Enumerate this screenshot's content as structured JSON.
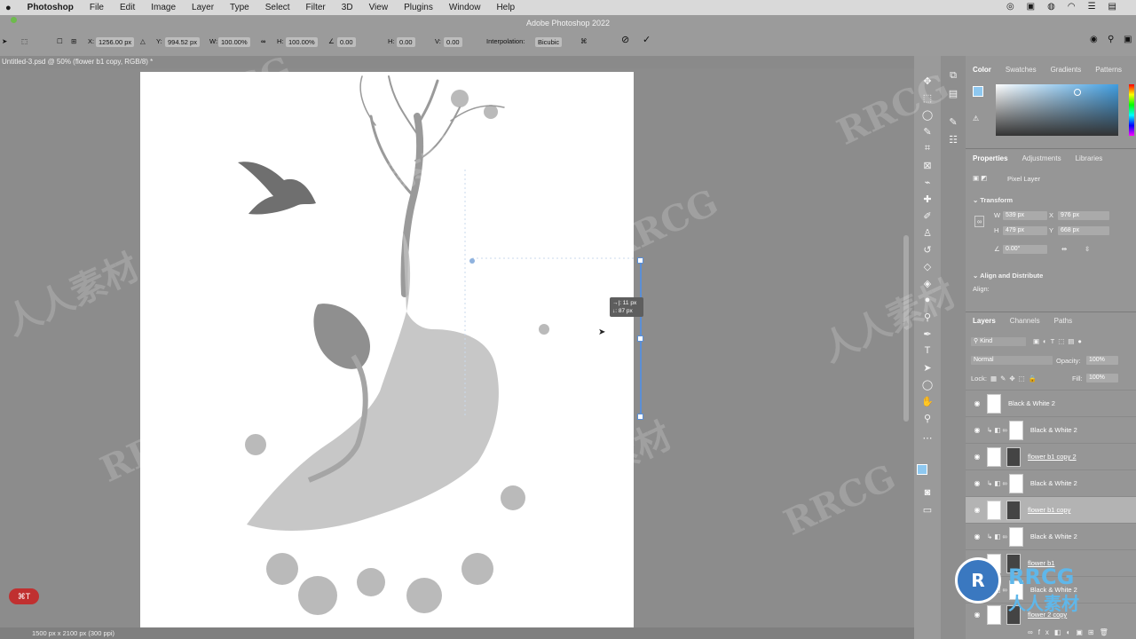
{
  "menubar": {
    "app": "Photoshop",
    "items": [
      "File",
      "Edit",
      "Image",
      "Layer",
      "Type",
      "Select",
      "Filter",
      "3D",
      "View",
      "Plugins",
      "Window",
      "Help"
    ]
  },
  "window_title": "Adobe Photoshop 2022",
  "options": {
    "x_label": "X:",
    "x_value": "1256.00 px",
    "y_label": "Y:",
    "y_value": "994.52 px",
    "w_label": "W:",
    "w_value": "100.00%",
    "h_label": "H:",
    "h_value": "100.00%",
    "angle_value": "0.00",
    "hskew_label": "H:",
    "hskew_value": "0.00",
    "vskew_label": "V:",
    "vskew_value": "0.00",
    "interp_label": "Interpolation:",
    "interp_value": "Bicubic"
  },
  "doc_tab": "Untitled-3.psd @ 50% (flower b1 copy, RGB/8) *",
  "status": "1500 px x 2100 px (300 ppi)",
  "measure": {
    "line1": "→|: 11 px",
    "line2": "↓: 87 px"
  },
  "shortcut_badge": "⌘T",
  "color_tabs": [
    "Color",
    "Swatches",
    "Gradients",
    "Patterns"
  ],
  "props_tabs": [
    "Properties",
    "Adjustments",
    "Libraries"
  ],
  "props": {
    "pixel_layer": "Pixel Layer",
    "transform": "Transform",
    "w_label": "W",
    "w": "539 px",
    "x_label": "X",
    "x": "976 px",
    "h_label": "H",
    "h": "479 px",
    "y_label": "Y",
    "y": "668 px",
    "angle": "0.00°",
    "align_distribute": "Align and Distribute",
    "align": "Align:"
  },
  "layers_tabs": [
    "Layers",
    "Channels",
    "Paths"
  ],
  "layers_ctrl": {
    "kind": "Kind",
    "blend": "Normal",
    "opacity_label": "Opacity:",
    "opacity": "100%",
    "lock_label": "Lock:",
    "fill_label": "Fill:",
    "fill": "100%"
  },
  "layers": [
    {
      "name": "Black & White 2"
    },
    {
      "name": "Black & White 2"
    },
    {
      "name": "flower b1 copy 2"
    },
    {
      "name": "Black & White 2"
    },
    {
      "name": "flower b1 copy"
    },
    {
      "name": "Black & White 2"
    },
    {
      "name": "flower b1"
    },
    {
      "name": "Black & White 2"
    },
    {
      "name": "flower 2 copy"
    }
  ],
  "watermarks": {
    "rrcg": "RRCG",
    "cn": "人人素材"
  },
  "colors": {
    "accent": "#5b8fd6",
    "fg_swatch": "#8ec8f0"
  }
}
